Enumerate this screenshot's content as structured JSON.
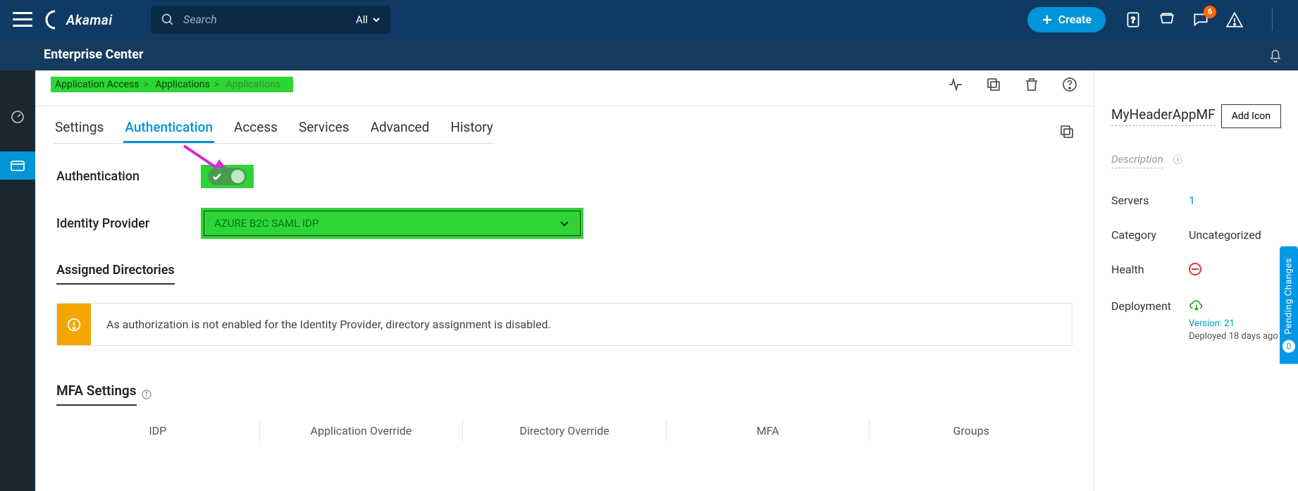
{
  "topbar": {
    "search_placeholder": "Search",
    "search_filter": "All",
    "create_label": "Create",
    "notification_count": "6"
  },
  "secondbar": {
    "title": "Enterprise Center"
  },
  "breadcrumbs": {
    "a": "Application Access",
    "b": "Applications",
    "c": "Applications"
  },
  "tabs": {
    "settings": "Settings",
    "authentication": "Authentication",
    "access": "Access",
    "services": "Services",
    "advanced": "Advanced",
    "history": "History"
  },
  "form": {
    "auth_label": "Authentication",
    "idp_label": "Identity Provider",
    "idp_value": "AZURE B2C SAML IDP",
    "assigned_dirs": "Assigned Directories",
    "alert_text": "As authorization is not enabled for the Identity Provider, directory assignment is disabled."
  },
  "mfa": {
    "heading": "MFA Settings",
    "cols": {
      "idp": "IDP",
      "app": "Application Override",
      "dir": "Directory Override",
      "mfa": "MFA",
      "groups": "Groups"
    }
  },
  "right": {
    "app_name": "MyHeaderAppMF",
    "add_icon": "Add Icon",
    "description": "Description",
    "servers_k": "Servers",
    "servers_v": "1",
    "category_k": "Category",
    "category_v": "Uncategorized",
    "health_k": "Health",
    "deployment_k": "Deployment",
    "version": "Version: 21",
    "deployed": "Deployed 18 days ago"
  },
  "pending": {
    "label": "Pending Changes",
    "count": "0"
  }
}
